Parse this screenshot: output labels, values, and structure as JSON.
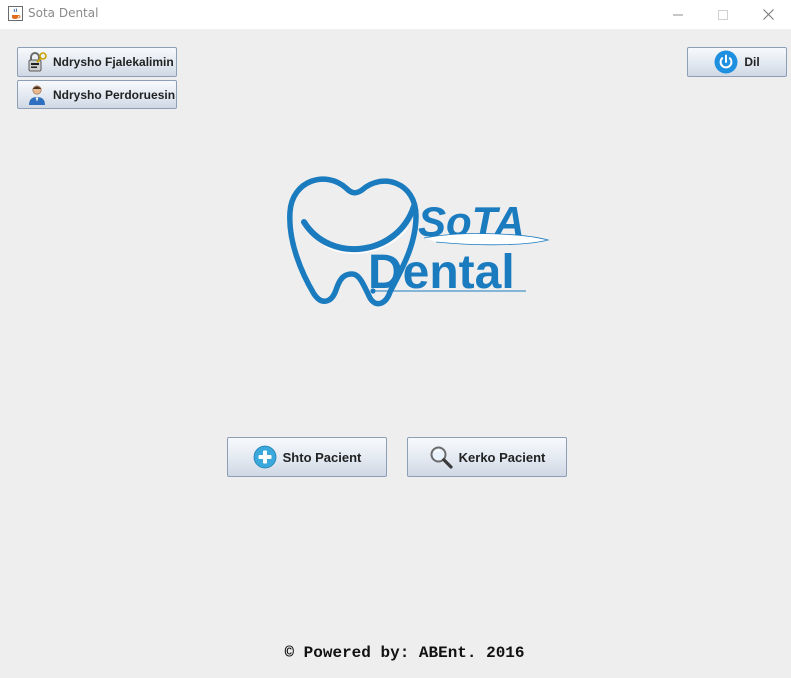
{
  "window": {
    "title": "Sota Dental",
    "app_icon": "java-cup-icon",
    "controls": [
      "minimize-icon",
      "maximize-icon",
      "close-icon"
    ]
  },
  "toolbar": {
    "change_password_label": "Ndrysho Fjalekalimin",
    "change_password_icon": "lock-key-icon",
    "change_user_label": "Ndrysho Perdoruesin",
    "change_user_icon": "user-icon",
    "exit_label": "Dil",
    "exit_icon": "power-icon"
  },
  "logo": {
    "text_top": "SoTA",
    "text_bottom": "Dental",
    "icon": "tooth-logo",
    "brand_color": "#1a7bbf"
  },
  "actions": {
    "add_patient_label": "Shto Pacient",
    "add_patient_icon": "plus-circle-icon",
    "search_patient_label": "Kerko Pacient",
    "search_patient_icon": "magnifier-icon"
  },
  "footer": {
    "text": "© Powered by: ABEnt. 2016"
  }
}
